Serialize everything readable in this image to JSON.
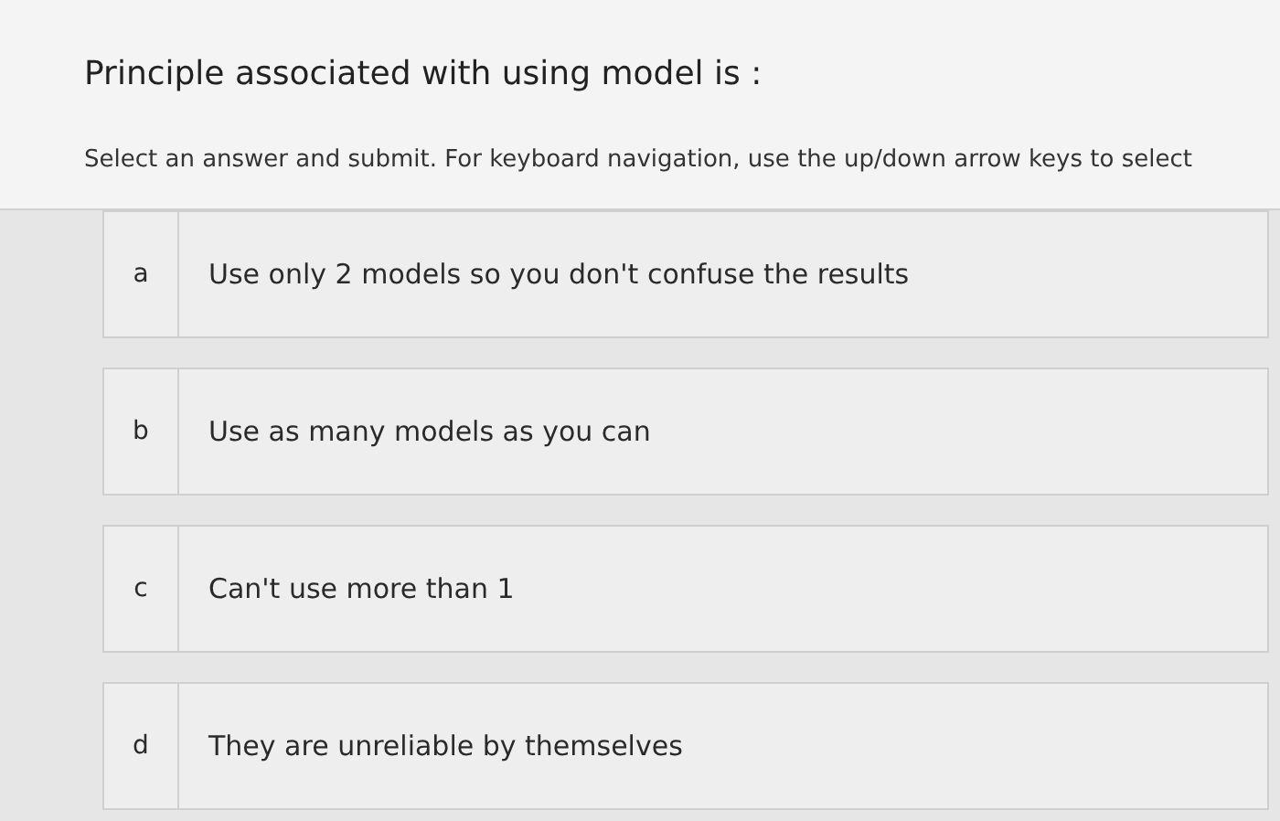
{
  "question": "Principle associated with using model is :",
  "instructions": "Select an answer and submit. For keyboard navigation, use the up/down arrow keys to select",
  "options": [
    {
      "letter": "a",
      "text": "Use only 2 models so you don't confuse the results",
      "selected": false
    },
    {
      "letter": "b",
      "text": "Use as many models as you can",
      "selected": false
    },
    {
      "letter": "c",
      "text": "Can't use more than 1",
      "selected": false
    },
    {
      "letter": "d",
      "text": "They are unreliable by themselves",
      "selected": false
    }
  ]
}
